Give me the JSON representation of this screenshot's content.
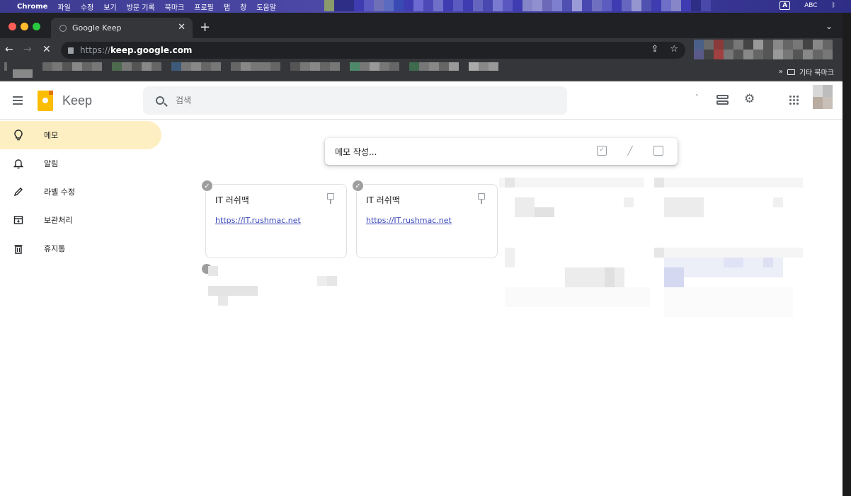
{
  "mac_menu": {
    "app_name": "Chrome",
    "items": [
      "파일",
      "수정",
      "보기",
      "방문 기록",
      "북마크",
      "프로필",
      "탭",
      "창",
      "도움말"
    ],
    "input_mode": "A",
    "input_source": "ABC"
  },
  "browser": {
    "tab_title": "Google Keep",
    "url_scheme": "https://",
    "url_host": "keep.google.com",
    "other_bookmarks": "기타 북마크"
  },
  "keep": {
    "app_title": "Keep",
    "search_placeholder": "검색",
    "sidebar": [
      {
        "label": "메모",
        "icon": "lightbulb-icon",
        "active": true
      },
      {
        "label": "알림",
        "icon": "bell-icon",
        "active": false
      },
      {
        "label": "라벨 수정",
        "icon": "pencil-icon",
        "active": false
      },
      {
        "label": "보관처리",
        "icon": "archive-icon",
        "active": false
      },
      {
        "label": "휴지통",
        "icon": "trash-icon",
        "active": false
      }
    ],
    "compose_placeholder": "메모 작성...",
    "notes": [
      {
        "title": "IT 러쉬맥",
        "link": "https://IT.rushmac.net"
      },
      {
        "title": "IT 러쉬맥",
        "link": "https://IT.rushmac.net"
      }
    ]
  },
  "colors": {
    "accent": "#fbbc04",
    "active_nav": "#feefc3",
    "link": "#3c4ab9"
  }
}
